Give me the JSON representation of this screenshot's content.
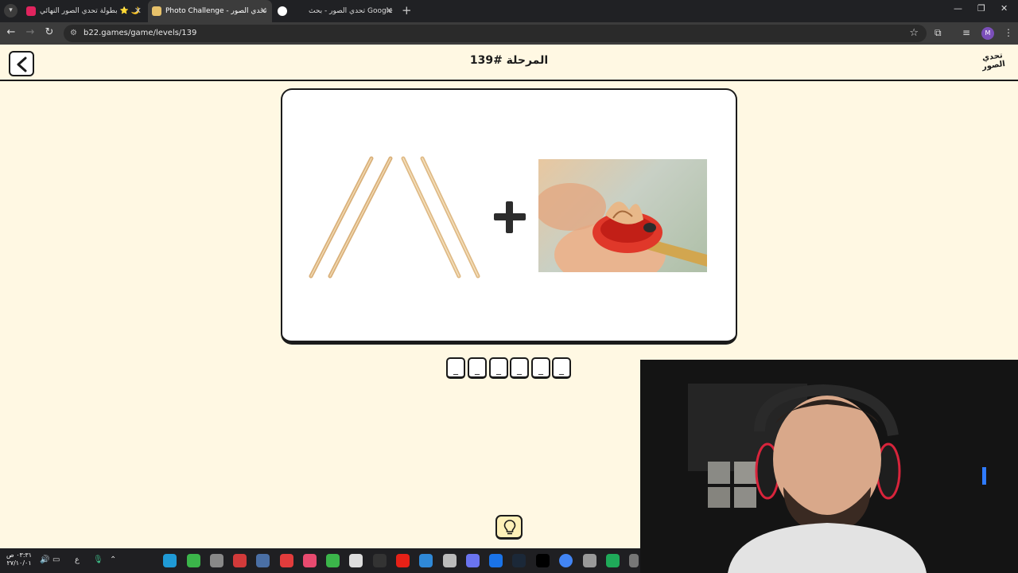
{
  "browser": {
    "tabs": [
      {
        "title": "بطولة تحدي الصور النهائي ⭐ 🌙",
        "active": false
      },
      {
        "title": "Photo Challenge - تحدي الصور",
        "active": true
      },
      {
        "title": "",
        "active": false
      },
      {
        "title": "تحدي الصور - بحث Google",
        "active": false
      }
    ],
    "url": "b22.games/game/levels/139",
    "profile_initial": "M"
  },
  "game": {
    "level_title": "المرحلة #139",
    "logo_text": "تحدي الصور",
    "clue_images": [
      "wooden-sticks-image",
      "pencil-sharpener-image"
    ],
    "operator": "+",
    "answer_slots": [
      "_",
      "_",
      "_",
      "_",
      "_",
      "_"
    ],
    "hint_icon": "lightbulb-icon"
  },
  "taskbar": {
    "clock_time": "٠٣:٣١ ص",
    "clock_date": "٢٧/١٠/٠١",
    "lang": "ع"
  },
  "colors": {
    "page_bg": "#fff8e3",
    "ink": "#1b1b1b",
    "chrome_dark": "#202124",
    "chrome_mid": "#3c3c3c"
  }
}
